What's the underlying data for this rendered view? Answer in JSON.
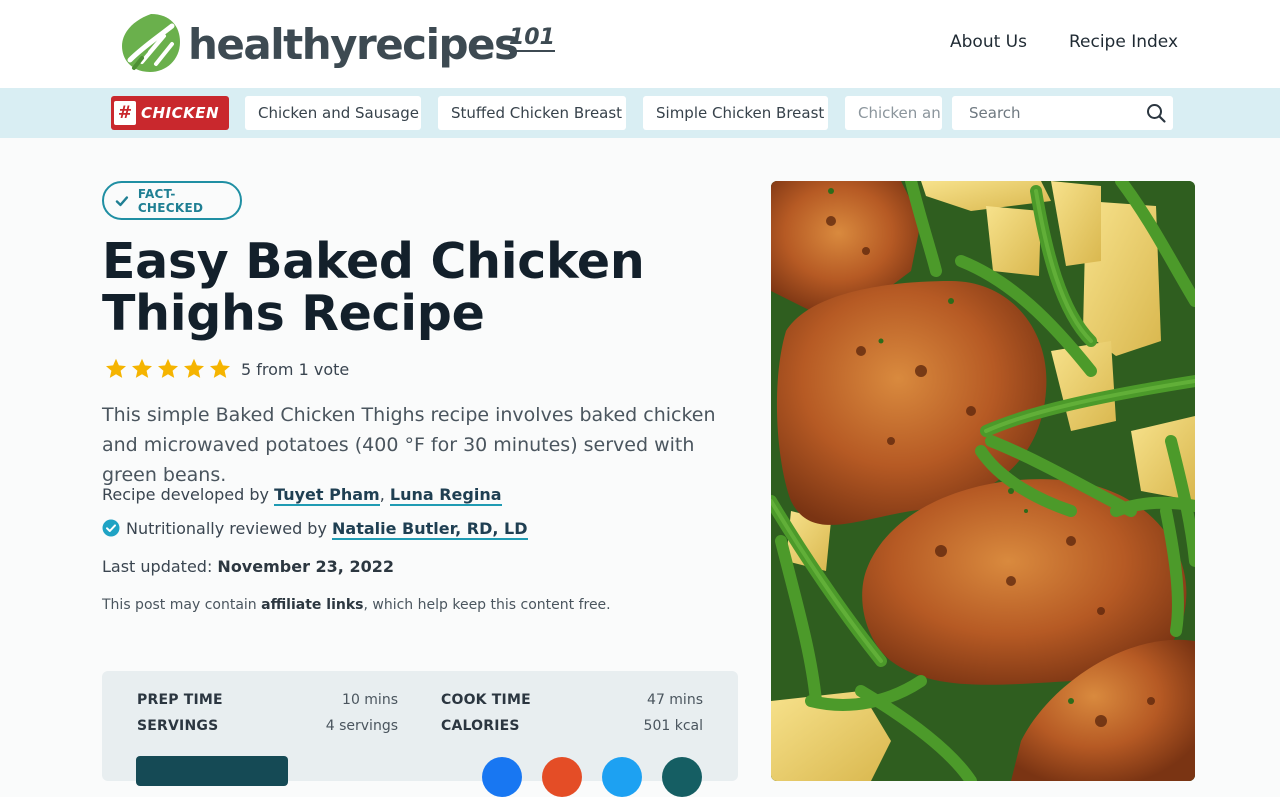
{
  "header": {
    "logo_text": "healthyrecipes",
    "logo_number": "101",
    "nav": [
      {
        "label": "About Us"
      },
      {
        "label": "Recipe Index"
      }
    ]
  },
  "category_bar": {
    "tag_hash": "#",
    "tag_label": "CHICKEN",
    "chips": [
      {
        "label": "Chicken and Sausage"
      },
      {
        "label": "Stuffed Chicken Breast"
      },
      {
        "label": "Simple Chicken Breast"
      },
      {
        "label": "Chicken an"
      }
    ],
    "search_placeholder": "Search"
  },
  "article": {
    "fact_checked": "FACT-CHECKED",
    "title": "Easy Baked Chicken Thighs Recipe",
    "rating_value": 5,
    "rating_max": 5,
    "rating_text": "5 from 1 vote",
    "description": "This simple Baked Chicken Thighs recipe involves baked chicken and microwaved potatoes (400 °F for 30 minutes) served with green beans.",
    "developed_prefix": "Recipe developed by ",
    "authors": [
      "Tuyet Pham",
      "Luna Regina"
    ],
    "author_separator": ", ",
    "reviewed_prefix": "Nutritionally reviewed by ",
    "reviewer": "Natalie Butler, RD, LD",
    "updated_prefix": "Last updated: ",
    "updated_date": "November 23, 2022",
    "affiliate_prefix": "This post may contain ",
    "affiliate_link": "affiliate links",
    "affiliate_suffix": ", which help keep this content free."
  },
  "info": {
    "prep_label": "PREP TIME",
    "prep_value": "10 mins",
    "cook_label": "COOK TIME",
    "cook_value": "47 mins",
    "servings_label": "SERVINGS",
    "servings_value": "4 servings",
    "calories_label": "CALORIES",
    "calories_value": "501 kcal"
  },
  "colors": {
    "accent": "#1f8fa3",
    "tag_red": "#c9282d",
    "category_bar": "#d9eef3",
    "logo_green": "#6ab04c",
    "star": "#f5b400",
    "social": [
      "#1877f2",
      "#e44d26",
      "#1da1f2",
      "#155e63"
    ]
  },
  "icons": {
    "logo": "leaf-fork-icon",
    "search": "search-icon",
    "fact": "check-icon",
    "verified": "verified-badge-icon",
    "star": "star-icon"
  }
}
